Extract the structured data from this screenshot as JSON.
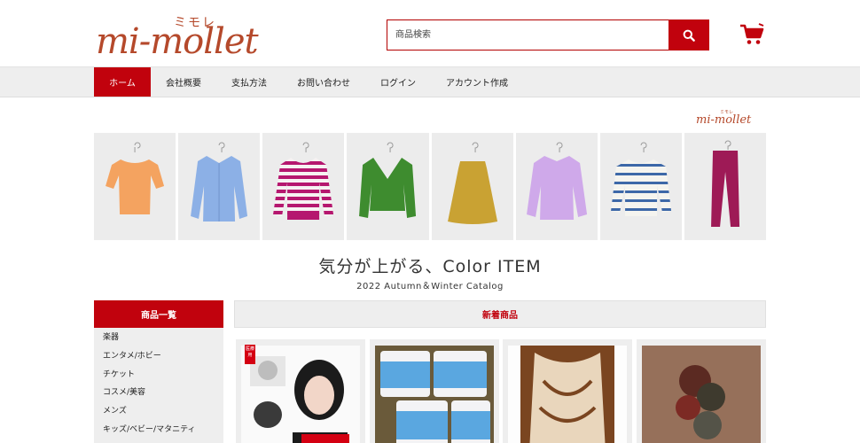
{
  "header": {
    "logo_text": "mi-mollet",
    "logo_kana": "ミモレ",
    "search": {
      "placeholder": "商品検索",
      "value": ""
    },
    "icons": {
      "search": "search-icon",
      "cart": "cart-icon"
    }
  },
  "nav": {
    "items": [
      {
        "label": "ホーム",
        "active": true
      },
      {
        "label": "会社概要"
      },
      {
        "label": "支払方法"
      },
      {
        "label": "お問い合わせ"
      },
      {
        "label": "ログイン"
      },
      {
        "label": "アカウント作成"
      }
    ]
  },
  "banner": {
    "logo_text": "mi-mollet",
    "logo_kana": "ミモレ",
    "title": "気分が上がる、Color ITEM",
    "subtitle": "2022 Autumn＆Winter Catalog",
    "items": [
      "orange-knit-top",
      "blue-shirt",
      "striped-cardigan",
      "green-cardigan",
      "mustard-skirt",
      "lilac-blouse",
      "striped-sweater",
      "magenta-pants"
    ]
  },
  "sidebar": {
    "heading": "商品一覧",
    "items": [
      {
        "label": "楽器"
      },
      {
        "label": "エンタメ/ホビー"
      },
      {
        "label": "チケット"
      },
      {
        "label": "コスメ/美容"
      },
      {
        "label": "メンズ"
      },
      {
        "label": "キッズ/ベビー/マタニティ"
      }
    ]
  },
  "new_items": {
    "heading": "新着商品",
    "products": [
      {
        "image": "wig-model-photo",
        "badge": "医療用"
      },
      {
        "image": "formula-cans-photo"
      },
      {
        "image": "knit-vest-photo"
      },
      {
        "image": "dried-flower-photo"
      }
    ]
  },
  "colors": {
    "brand_red": "#c1020d",
    "logo_brown": "#b5492b",
    "nav_bg": "#eeeeee"
  }
}
